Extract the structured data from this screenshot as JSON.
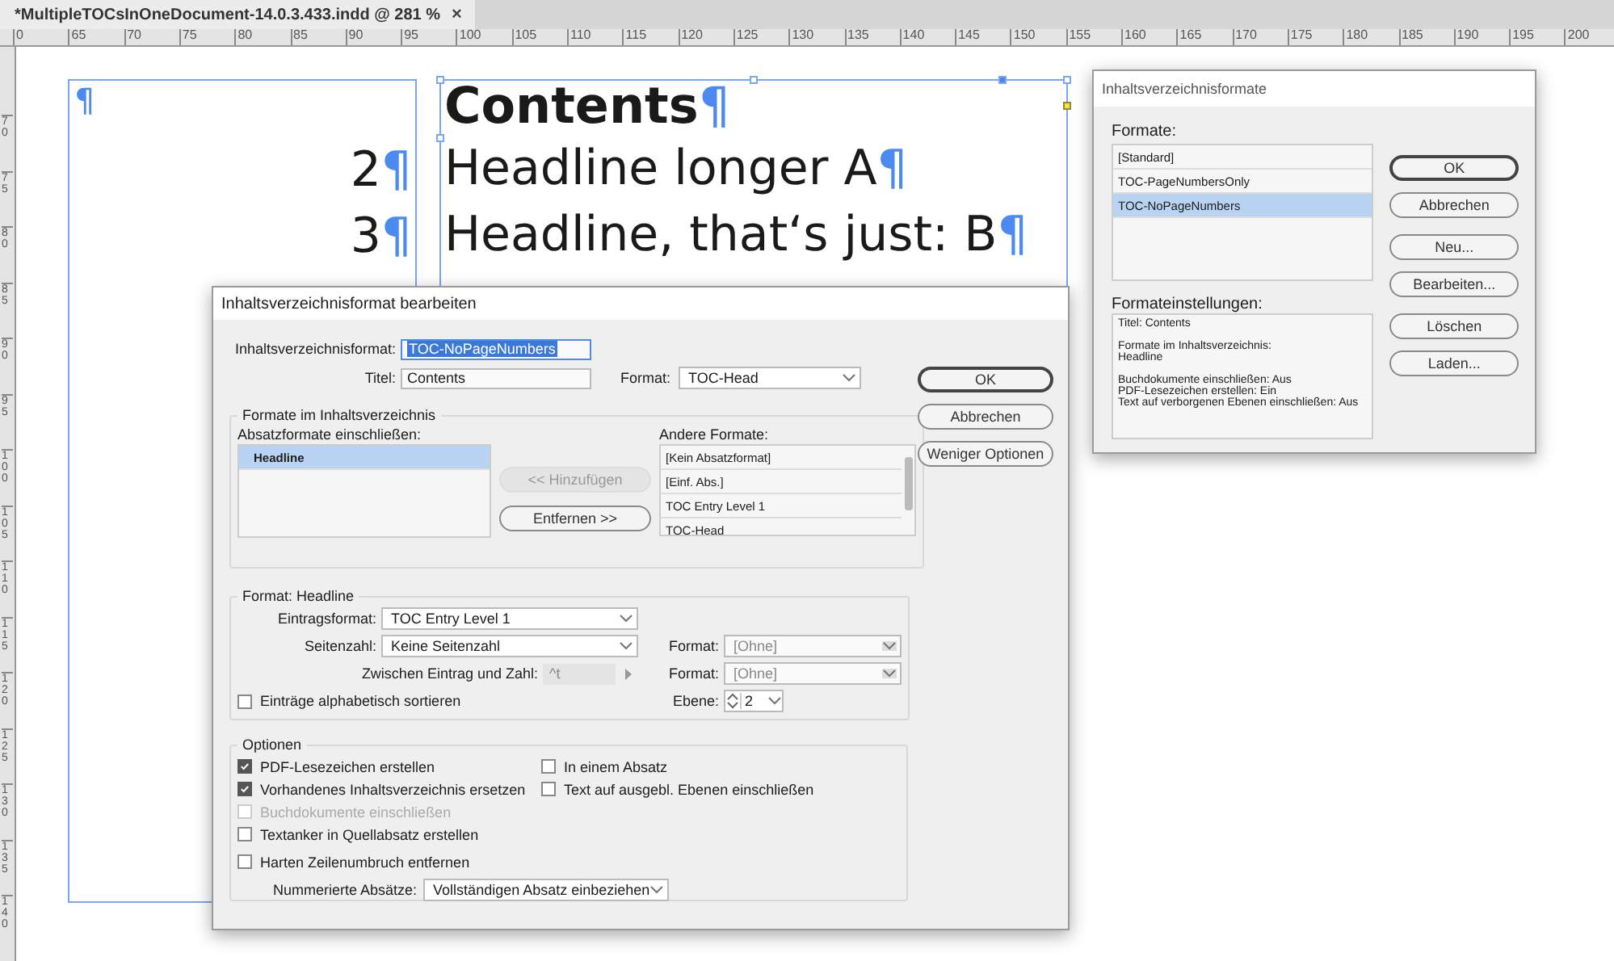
{
  "document_tab": {
    "title": "*MultipleTOCsInOneDocument-14.0.3.433.indd @ 281 %",
    "close": "×"
  },
  "ruler": {
    "horizontal": [
      "0",
      "65",
      "70",
      "75",
      "80",
      "85",
      "90",
      "95",
      "100",
      "105",
      "110",
      "115",
      "120",
      "125",
      "130",
      "135",
      "140",
      "145",
      "150",
      "155",
      "160",
      "165",
      "170",
      "175",
      "180",
      "185",
      "190",
      "195",
      "200"
    ],
    "vertical": [
      "70",
      "75",
      "80",
      "85",
      "90",
      "95",
      "100",
      "105",
      "110",
      "115",
      "120",
      "125",
      "130",
      "135",
      "140"
    ]
  },
  "page": {
    "number_frame": {
      "lines": [
        {
          "mark": "¶",
          "kind": "empty"
        },
        {
          "text": "2",
          "mark": "¶",
          "kind": "number"
        },
        {
          "text": "3",
          "mark": "¶",
          "kind": "number"
        }
      ]
    },
    "entry_frame": {
      "lines": [
        {
          "text": "Contents",
          "mark": "¶",
          "kind": "heading"
        },
        {
          "text": "Headline longer A",
          "mark": "¶",
          "kind": "entry"
        },
        {
          "text": "Headline, that‘s just: B",
          "mark": "¶",
          "kind": "entry"
        }
      ]
    }
  },
  "edit_dialog": {
    "title": "Inhaltsverzeichnisformat bearbeiten",
    "toc_format": {
      "label": "Inhaltsverzeichnisformat:",
      "value": "TOC-NoPageNumbers",
      "text_selected": true
    },
    "title_field": {
      "label": "Titel:",
      "value": "Contents"
    },
    "title_format": {
      "label": "Format:",
      "value": "TOC-Head"
    },
    "buttons": [
      {
        "label": "OK",
        "default": true
      },
      {
        "label": "Abbrechen",
        "default": false
      },
      {
        "label": "Weniger Optionen",
        "default": false
      }
    ],
    "styles_group": {
      "legend": "Formate im Inhaltsverzeichnis",
      "include_label": "Absatzformate einschließen:",
      "include_items": [
        {
          "label": "Headline",
          "selected": true
        }
      ],
      "add_button": {
        "label": "<< Hinzufügen",
        "disabled": true
      },
      "remove_button": {
        "label": "Entfernen >>",
        "disabled": false
      },
      "other_label": "Andere Formate:",
      "other_items": [
        {
          "label": "[Kein Absatzformat]",
          "selected": false
        },
        {
          "label": "[Einf. Abs.]",
          "selected": false
        },
        {
          "label": "TOC Entry Level 1",
          "selected": false
        },
        {
          "label": "TOC-Head",
          "selected": false
        }
      ]
    },
    "style_group": {
      "legend": "Format: Headline",
      "entry_style": {
        "label": "Eintragsformat:",
        "value": "TOC Entry Level 1",
        "disabled": false
      },
      "page_number": {
        "label": "Seitenzahl:",
        "value": "Keine Seitenzahl",
        "disabled": false
      },
      "page_number_style": {
        "label": "Format:",
        "value": "[Ohne]",
        "disabled": true
      },
      "between": {
        "label": "Zwischen Eintrag und Zahl:",
        "value": "^t",
        "disabled": true
      },
      "between_style": {
        "label": "Format:",
        "value": "[Ohne]",
        "disabled": true
      },
      "sort": {
        "label": "Einträge alphabetisch sortieren",
        "checked": false,
        "disabled": false
      },
      "level": {
        "label": "Ebene:",
        "value": "2"
      }
    },
    "options_group": {
      "legend": "Optionen",
      "left": [
        {
          "label": "PDF-Lesezeichen erstellen",
          "checked": true,
          "disabled": false
        },
        {
          "label": "Vorhandenes Inhaltsverzeichnis ersetzen",
          "checked": true,
          "disabled": false
        },
        {
          "label": "Buchdokumente einschließen",
          "checked": false,
          "disabled": true
        },
        {
          "label": "Textanker in Quellabsatz erstellen",
          "checked": false,
          "disabled": false
        }
      ],
      "right": [
        {
          "label": "In einem Absatz",
          "checked": false,
          "disabled": false
        },
        {
          "label": "Text auf ausgebl. Ebenen einschließen",
          "checked": false,
          "disabled": false
        }
      ],
      "hard_break": {
        "label": "Harten Zeilenumbruch entfernen",
        "checked": false,
        "disabled": false
      },
      "numbered": {
        "label": "Nummerierte Absätze:",
        "value": "Vollständigen Absatz einbeziehen",
        "disabled": false
      }
    }
  },
  "formats_dialog": {
    "title": "Inhaltsverzeichnisformate",
    "formats_label": "Formate:",
    "formats": [
      {
        "label": "[Standard]",
        "selected": false
      },
      {
        "label": "TOC-PageNumbersOnly",
        "selected": false
      },
      {
        "label": "TOC-NoPageNumbers",
        "selected": true
      }
    ],
    "settings_label": "Formateinstellungen:",
    "settings": [
      [
        "Titel: Contents"
      ],
      [
        "Formate im Inhaltsverzeichnis:",
        "Headline"
      ],
      [
        "Buchdokumente einschließen: Aus",
        "PDF-Lesezeichen erstellen: Ein",
        "Text auf verborgenen Ebenen einschließen: Aus"
      ]
    ],
    "button_groups": [
      [
        {
          "label": "OK",
          "default": true
        },
        {
          "label": "Abbrechen",
          "default": false
        }
      ],
      [
        {
          "label": "Neu...",
          "default": false
        },
        {
          "label": "Bearbeiten...",
          "default": false
        }
      ],
      [
        {
          "label": "Löschen",
          "default": false
        },
        {
          "label": "Laden...",
          "default": false
        }
      ]
    ]
  }
}
